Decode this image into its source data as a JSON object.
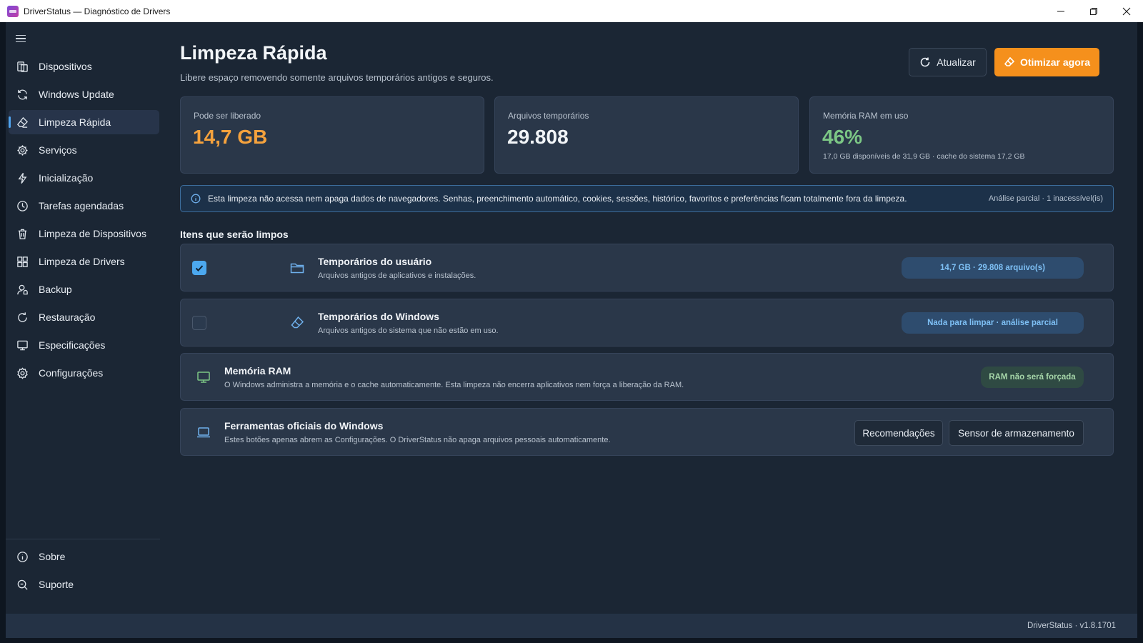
{
  "window": {
    "title": "DriverStatus — Diagnóstico de Drivers",
    "controls": [
      "minimize-icon",
      "maximize-icon",
      "close-icon"
    ]
  },
  "sidebar": {
    "menu_icon": "hamburger-icon",
    "items": [
      {
        "label": "Dispositivos",
        "icon": "devices-icon"
      },
      {
        "label": "Windows Update",
        "icon": "sync-icon"
      },
      {
        "label": "Limpeza Rápida",
        "icon": "eraser-icon",
        "active": true
      },
      {
        "label": "Serviços",
        "icon": "gear-icon"
      },
      {
        "label": "Inicialização",
        "icon": "lightning-icon"
      },
      {
        "label": "Tarefas agendadas",
        "icon": "clock-icon"
      },
      {
        "label": "Limpeza de Dispositivos",
        "icon": "trash-icon"
      },
      {
        "label": "Limpeza de Drivers",
        "icon": "apps-icon"
      },
      {
        "label": "Backup",
        "icon": "backup-icon"
      },
      {
        "label": "Restauração",
        "icon": "restore-icon"
      },
      {
        "label": "Especificações",
        "icon": "monitor-icon"
      },
      {
        "label": "Configurações",
        "icon": "settings-icon"
      }
    ],
    "footer_items": [
      {
        "label": "Sobre",
        "icon": "info-icon"
      },
      {
        "label": "Suporte",
        "icon": "support-icon"
      }
    ]
  },
  "header": {
    "title": "Limpeza Rápida",
    "subtitle": "Libere espaço removendo somente arquivos temporários antigos e seguros.",
    "refresh_label": "Atualizar",
    "optimize_label": "Otimizar agora"
  },
  "stats": [
    {
      "label": "Pode ser liberado",
      "value": "14,7 GB",
      "color": "#f5a23d",
      "sub": ""
    },
    {
      "label": "Arquivos temporários",
      "value": "29.808",
      "color": "#f2f5f8",
      "sub": ""
    },
    {
      "label": "Memória RAM em uso",
      "value": "46%",
      "color": "#7cc785",
      "sub": "17,0 GB disponíveis de 31,9 GB · cache do sistema 17,2 GB"
    }
  ],
  "info": {
    "text": "Esta limpeza não acessa nem apaga dados de navegadores. Senhas, preenchimento automático, cookies, sessões, histórico, favoritos e preferências ficam totalmente fora da limpeza.",
    "status": "Análise parcial · 1 inacessível(is)"
  },
  "section_title": "Itens que serão limpos",
  "items": [
    {
      "title": "Temporários do usuário",
      "desc": "Arquivos antigos de aplicativos e instalações.",
      "checked": true,
      "icon": "folder-icon",
      "badge": "14,7 GB · 29.808 arquivo(s)"
    },
    {
      "title": "Temporários do Windows",
      "desc": "Arquivos antigos do sistema que não estão em uso.",
      "checked": false,
      "icon": "eraser-icon",
      "badge": "Nada para limpar · análise parcial"
    },
    {
      "title": "Memória RAM",
      "desc": "O Windows administra a memória e o cache automaticamente. Esta limpeza não encerra aplicativos nem força a liberação da RAM.",
      "icon": "monitor-icon",
      "badge": "RAM não será forçada"
    },
    {
      "title": "Ferramentas oficiais do Windows",
      "desc": "Estes botões apenas abrem as Configurações. O DriverStatus não apaga arquivos pessoais automaticamente.",
      "icon": "laptop-icon",
      "buttons": [
        "Recomendações",
        "Sensor de armazenamento"
      ]
    }
  ],
  "statusbar": {
    "version": "DriverStatus · v1.8.1701"
  },
  "colors": {
    "accent": "#4ca8ef",
    "primary_button": "#f5901c",
    "background": "#1b2634",
    "card": "#2a3749"
  }
}
